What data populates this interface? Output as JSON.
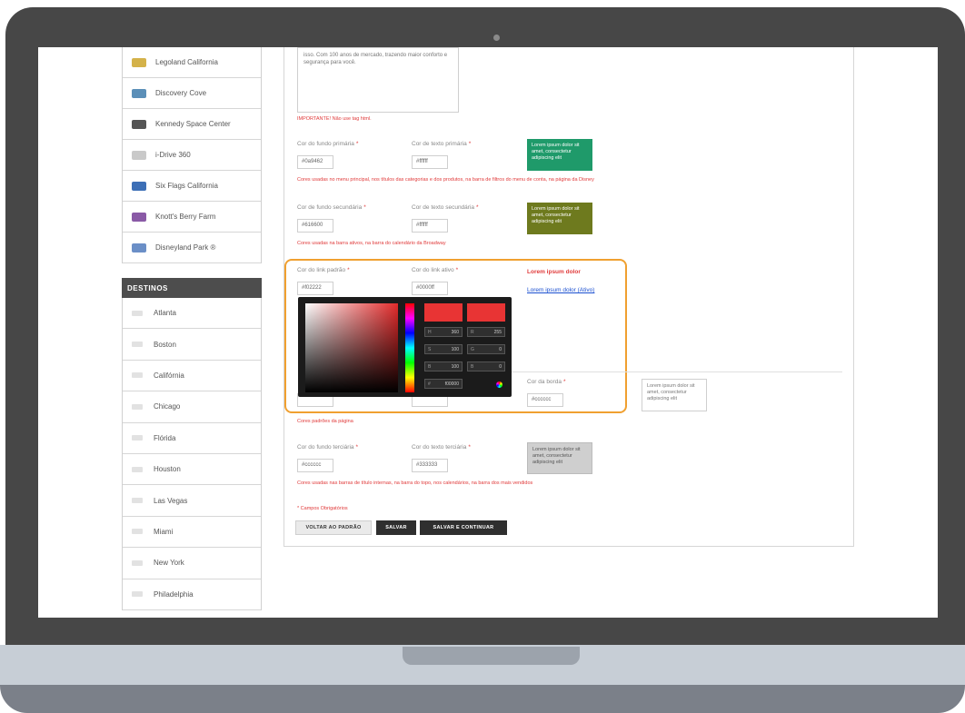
{
  "sidebar": {
    "parks": [
      {
        "label": "Legoland California",
        "logo_color": "#d4b24a"
      },
      {
        "label": "Discovery Cove",
        "logo_color": "#5b8fb8"
      },
      {
        "label": "Kennedy Space Center",
        "logo_color": "#555555"
      },
      {
        "label": "i-Drive 360",
        "logo_color": "#c9c9c9"
      },
      {
        "label": "Six Flags California",
        "logo_color": "#3d6fb6"
      },
      {
        "label": "Knott's Berry Farm",
        "logo_color": "#8a5aa6"
      },
      {
        "label": "Disneyland Park ®",
        "logo_color": "#6b8fc7"
      }
    ],
    "destinations_header": "DESTINOS",
    "destinations": [
      "Atlanta",
      "Boston",
      "Califórnia",
      "Chicago",
      "Flórida",
      "Houston",
      "Las Vegas",
      "Miami",
      "New York",
      "Philadelphia"
    ]
  },
  "form": {
    "textarea_text": "isso. Com 100 anos de mercado, trazendo maior conforto e segurança para você.",
    "important_note": "IMPORTANTE! Não use tag html.",
    "primary": {
      "bg_label": "Cor do fundo primária",
      "bg_value": "#0a9462",
      "text_label": "Cor de texto primária",
      "text_value": "#ffffff",
      "preview_text": "Lorem ipsum dolor sit amet, consectetur adipiscing elit",
      "preview_bg": "#1f9a6a",
      "note": "Cores usadas no menu principal, nos títulos das categorias e dos produtos, na barra de filtros do menu de conta, na página da Disney"
    },
    "secondary": {
      "bg_label": "Cor de fundo secundária",
      "bg_value": "#616600",
      "text_label": "Cor de texto secundária",
      "text_value": "#ffffff",
      "preview_text": "Lorem ipsum dolor sit amet, consectetur adipiscing elit",
      "preview_bg": "#6e7a1e",
      "note": "Cores usadas na barra ativos, na barra do calendário da Broadway"
    },
    "links": {
      "link_label": "Cor do link padrão",
      "link_value": "#f02222",
      "active_label": "Cor do link ativo",
      "active_value": "#0000ff",
      "link_sample": "Lorem ipsum dolor",
      "active_sample": "Lorem ipsum dolor (Ativo)",
      "link_color": "#e03a3a",
      "active_color": "#1a4fd0"
    },
    "picker": {
      "current_color": "#e83434",
      "new_color": "#e83434",
      "h_label": "H",
      "h_value": "360",
      "s_label": "S",
      "s_value": "100",
      "b_label": "B",
      "b_value": "100",
      "r_label": "R",
      "r_value": "255",
      "g_label": "G",
      "g_value": "0",
      "bl_label": "B",
      "bl_value": "0",
      "hex_label": "#",
      "hex_value": "f00000"
    },
    "border": {
      "label": "Cor da borda",
      "value": "#cccccc",
      "preview_text": "Lorem ipsum dolor sit amet, consectetur adipiscing elit"
    },
    "defaults_note": "Cores padrões da página",
    "tertiary": {
      "bg_label": "Cor do fundo terciária",
      "bg_value": "#cccccc",
      "text_label": "Cor do texto terciária",
      "text_value": "#333333",
      "preview_text": "Lorem ipsum dolor sit amet, consectetur adipiscing elit",
      "preview_bg": "#cfcfcf",
      "note": "Cores usadas nas barras de título internas, na barra do topo, nos calendários, na barra dos mais vendidos"
    },
    "required_note": "* Campos Obrigatórios",
    "buttons": {
      "reset": "VOLTAR AO PADRÃO",
      "save": "SALVAR",
      "save_continue": "SALVAR E CONTINUAR"
    }
  }
}
